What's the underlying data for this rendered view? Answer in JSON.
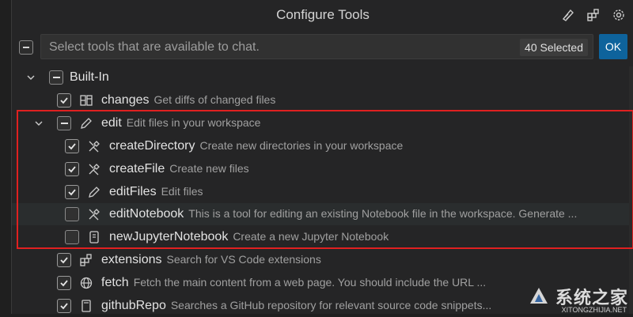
{
  "header": {
    "title": "Configure Tools",
    "icons": [
      "feedback-icon",
      "extensions-icon",
      "gear-icon"
    ]
  },
  "search": {
    "placeholder": "Select tools that are available to chat.",
    "value": "",
    "selected_badge": "40 Selected",
    "ok_label": "OK"
  },
  "tree": {
    "builtin": {
      "label": "Built-In",
      "state": "partial",
      "expanded": true
    },
    "items": [
      {
        "label": "changes",
        "desc": "Get diffs of changed files",
        "icon": "diff-icon",
        "checked": true
      },
      {
        "label": "edit",
        "desc": "Edit files in your workspace",
        "icon": "pencil-icon",
        "state": "partial",
        "expanded": true
      },
      {
        "label": "createDirectory",
        "desc": "Create new directories in your workspace",
        "icon": "tools-icon",
        "checked": true
      },
      {
        "label": "createFile",
        "desc": "Create new files",
        "icon": "tools-icon",
        "checked": true
      },
      {
        "label": "editFiles",
        "desc": "Edit files",
        "icon": "pencil-icon",
        "checked": true
      },
      {
        "label": "editNotebook",
        "desc": "This is a tool for editing an existing Notebook file in the workspace. Generate ...",
        "icon": "tools-icon",
        "checked": false
      },
      {
        "label": "newJupyterNotebook",
        "desc": "Create a new Jupyter Notebook",
        "icon": "notebook-icon",
        "checked": false
      },
      {
        "label": "extensions",
        "desc": "Search for VS Code extensions",
        "icon": "extensions-icon",
        "checked": true
      },
      {
        "label": "fetch",
        "desc": "Fetch the main content from a web page. You should include the URL ...",
        "icon": "globe-icon",
        "checked": true
      },
      {
        "label": "githubRepo",
        "desc": "Searches a GitHub repository for relevant source code snippets...",
        "icon": "repo-icon",
        "checked": true
      }
    ]
  },
  "watermark": {
    "text": "系统之家",
    "sub": "XITONGZHIJIA.NET"
  },
  "colors": {
    "accent": "#0e639c",
    "highlight": "#e02020",
    "background": "#252526"
  }
}
